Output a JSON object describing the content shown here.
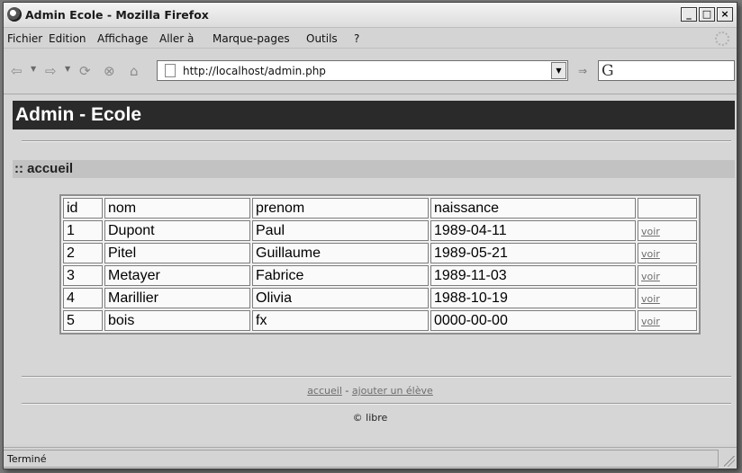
{
  "window": {
    "title": "Admin Ecole - Mozilla Firefox",
    "buttons": {
      "minimize": "_",
      "maximize": "□",
      "close": "×"
    }
  },
  "menu": {
    "items": [
      "Fichier",
      "Edition",
      "Affichage",
      "Aller à",
      "Marque-pages",
      "Outils",
      "?"
    ]
  },
  "toolbar": {
    "url": "http://localhost/admin.php",
    "search_engine_glyph": "G"
  },
  "page": {
    "header": "Admin - Ecole",
    "section_title": ":: accueil",
    "table": {
      "columns": [
        "id",
        "nom",
        "prenom",
        "naissance",
        ""
      ],
      "rows": [
        {
          "id": "1",
          "nom": "Dupont",
          "prenom": "Paul",
          "naissance": "1989-04-11",
          "action": "voir"
        },
        {
          "id": "2",
          "nom": "Pitel",
          "prenom": "Guillaume",
          "naissance": "1989-05-21",
          "action": "voir"
        },
        {
          "id": "3",
          "nom": "Metayer",
          "prenom": "Fabrice",
          "naissance": "1989-11-03",
          "action": "voir"
        },
        {
          "id": "4",
          "nom": "Marillier",
          "prenom": "Olivia",
          "naissance": "1988-10-19",
          "action": "voir"
        },
        {
          "id": "5",
          "nom": "bois",
          "prenom": "fx",
          "naissance": "0000-00-00",
          "action": "voir"
        }
      ]
    },
    "footer": {
      "link_home": "accueil",
      "separator": "-",
      "link_add": "ajouter un élève",
      "copyright": "© libre"
    }
  },
  "status": {
    "text": "Terminé"
  }
}
